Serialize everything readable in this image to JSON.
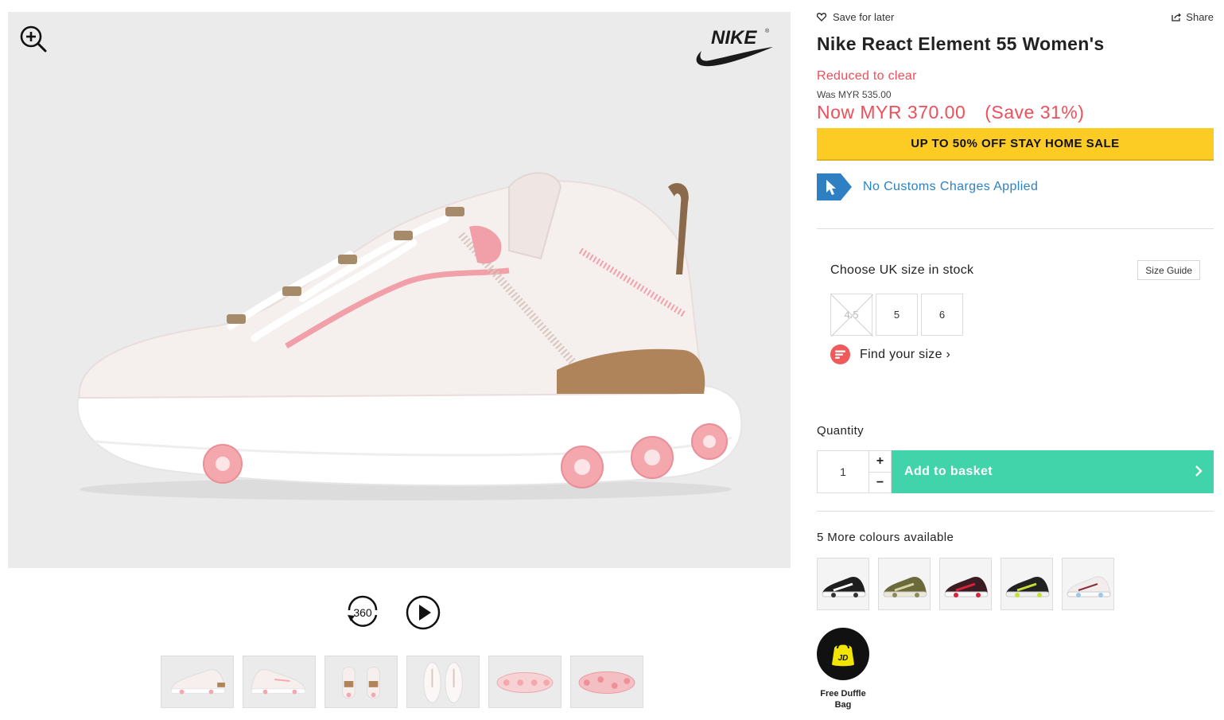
{
  "product": {
    "title": "Nike React Element 55 Women's",
    "reduced_label": "Reduced to clear",
    "was_price": "Was MYR 535.00",
    "now_price": "Now MYR 370.00",
    "save_text": "(Save 31%)"
  },
  "actions": {
    "save_for_later": "Save for later",
    "share": "Share"
  },
  "promo": {
    "text": "UP TO 50% OFF STAY HOME SALE"
  },
  "customs": {
    "text": "No Customs Charges Applied"
  },
  "sizes": {
    "title": "Choose UK size in stock",
    "guide_label": "Size Guide",
    "options": [
      {
        "label": "4.5",
        "in_stock": false
      },
      {
        "label": "5",
        "in_stock": true
      },
      {
        "label": "6",
        "in_stock": true
      }
    ],
    "find_size_label": "Find your size ›"
  },
  "quantity": {
    "label": "Quantity",
    "value": "1",
    "plus": "+",
    "minus": "−"
  },
  "basket": {
    "label": "Add to basket"
  },
  "colours": {
    "title": "5 More colours available",
    "swatches": [
      "black-white",
      "olive-khaki",
      "black-red",
      "black-volt",
      "white-pink"
    ]
  },
  "gift": {
    "text": "Free Duffle Bag",
    "badge": "JD"
  },
  "media": {
    "spin_label": "360",
    "thumbnail_views": [
      "side",
      "side-alt",
      "heels",
      "top",
      "sole",
      "sole-alt"
    ]
  },
  "brand": {
    "name": "NIKE",
    "trademark": "®"
  },
  "colors": {
    "sale_red": "#ef4f5a",
    "promo_yellow": "#fccb24",
    "basket_green": "#41d3aa",
    "customs_blue": "#2b82c5"
  }
}
